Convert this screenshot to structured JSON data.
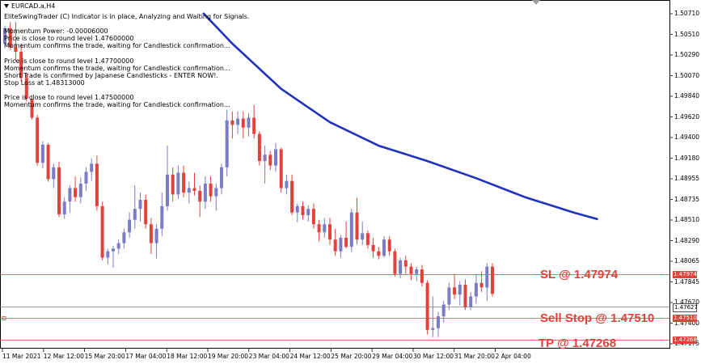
{
  "chart": {
    "symbol_label": "EURCAD.a,H4",
    "indicator_lines": [
      "EliteSwingTrader (C) Indicator is in place, Analyzing and Waiting for Signals.",
      "",
      "Momentum Power: -0.00006000",
      "Price is close to round level 1.47600000",
      "Momentum confirms the trade, waiting for Candlestick confirmation...",
      "",
      "Price is close to round level 1.47700000",
      "Momentum confirms the trade, waiting for Candlestick confirmation...",
      "Short Trade is confirmed by Japanese Candlesticks - ENTER NOW!.",
      "Stop Loss at 1.48313000",
      "",
      "Price is close to round level 1.47500000",
      "Momentum confirms the trade, waiting for Candlestick confirmation..."
    ],
    "levels": {
      "sl_text": "SL @ 1.47974",
      "entry_text": "Sell Stop @ 1.47510",
      "tp_text": "TP @ 1.47268",
      "sl_tag": "1.47974",
      "current_tag": "1.47627",
      "entry_tag": "1.47510",
      "tp_tag": "1.47268"
    },
    "colors": {
      "bull": "#7b7bc6",
      "bear": "#e3413b",
      "ma": "#1f32c0",
      "level_line": "#e3413b",
      "current_line": "#7f7f7f",
      "annotation": "#e3413b"
    }
  },
  "chart_data": {
    "type": "candlestick",
    "title": "EURCAD.a,H4",
    "ylim": [
      1.47175,
      1.5079
    ],
    "y_ticks": [
      "1.50710",
      "1.50510",
      "1.50290",
      "1.50070",
      "1.49840",
      "1.49620",
      "1.49400",
      "1.49180",
      "1.48955",
      "1.48735",
      "1.48510",
      "1.48290",
      "1.48065",
      "1.47845",
      "1.47620",
      "1.47400",
      "1.47175"
    ],
    "x_labels": [
      "11 Mar 2021",
      "12 Mar 12:00",
      "15 Mar 20:00",
      "17 Mar 04:00",
      "18 Mar 12:00",
      "19 Mar 20:00",
      "23 Mar 04:00",
      "24 Mar 12:00",
      "25 Mar 20:00",
      "29 Mar 04:00",
      "30 Mar 12:00",
      "31 Mar 20:00",
      "2 Apr 04:00"
    ],
    "candles": [
      [
        1.5045,
        1.5065,
        1.5041,
        1.5062
      ],
      [
        1.5062,
        1.5069,
        1.5038,
        1.5041
      ],
      [
        1.5041,
        1.5069,
        1.5025,
        1.5036
      ],
      [
        1.5036,
        1.5045,
        1.5003,
        1.5007
      ],
      [
        1.5007,
        1.5012,
        1.4981,
        1.4984
      ],
      [
        1.4984,
        1.4988,
        1.4961,
        1.4963
      ],
      [
        1.4963,
        1.4966,
        1.491,
        1.4913
      ],
      [
        1.4913,
        1.4937,
        1.4907,
        1.4933
      ],
      [
        1.4933,
        1.4935,
        1.4892,
        1.4895
      ],
      [
        1.4895,
        1.4912,
        1.4885,
        1.4908
      ],
      [
        1.4908,
        1.4914,
        1.4853,
        1.4856
      ],
      [
        1.4856,
        1.4875,
        1.4851,
        1.487
      ],
      [
        1.487,
        1.4888,
        1.4858,
        1.4885
      ],
      [
        1.4885,
        1.4898,
        1.487,
        1.4875
      ],
      [
        1.4875,
        1.4897,
        1.4868,
        1.489
      ],
      [
        1.489,
        1.4908,
        1.4882,
        1.4903
      ],
      [
        1.4903,
        1.4918,
        1.4893,
        1.4912
      ],
      [
        1.4912,
        1.4921,
        1.486,
        1.4865
      ],
      [
        1.4865,
        1.487,
        1.4805,
        1.4808
      ],
      [
        1.4808,
        1.4818,
        1.4801,
        1.4815
      ],
      [
        1.4815,
        1.4821,
        1.4797,
        1.4818
      ],
      [
        1.4818,
        1.4828,
        1.4812,
        1.4824
      ],
      [
        1.4824,
        1.484,
        1.4818,
        1.4836
      ],
      [
        1.4836,
        1.4858,
        1.483,
        1.485
      ],
      [
        1.485,
        1.4888,
        1.484,
        1.4862
      ],
      [
        1.4862,
        1.488,
        1.4848,
        1.4872
      ],
      [
        1.4872,
        1.4878,
        1.484,
        1.4845
      ],
      [
        1.4845,
        1.4852,
        1.4812,
        1.4824
      ],
      [
        1.4824,
        1.4845,
        1.4807,
        1.484
      ],
      [
        1.484,
        1.488,
        1.4832,
        1.4865
      ],
      [
        1.4865,
        1.4932,
        1.486,
        1.49
      ],
      [
        1.49,
        1.4908,
        1.487,
        1.4878
      ],
      [
        1.4878,
        1.491,
        1.4873,
        1.4902
      ],
      [
        1.4902,
        1.491,
        1.4875,
        1.488
      ],
      [
        1.488,
        1.4892,
        1.4868,
        1.4885
      ],
      [
        1.4885,
        1.4902,
        1.4877,
        1.4882
      ],
      [
        1.4882,
        1.4888,
        1.4853,
        1.487
      ],
      [
        1.487,
        1.4898,
        1.4862,
        1.489
      ],
      [
        1.489,
        1.4898,
        1.487,
        1.4876
      ],
      [
        1.4876,
        1.489,
        1.486,
        1.4885
      ],
      [
        1.4885,
        1.4912,
        1.4878,
        1.4908
      ],
      [
        1.4908,
        1.4972,
        1.4898,
        1.496
      ],
      [
        1.496,
        1.497,
        1.494,
        1.4955
      ],
      [
        1.4955,
        1.497,
        1.4945,
        1.4962
      ],
      [
        1.4962,
        1.497,
        1.494,
        1.4952
      ],
      [
        1.4952,
        1.4968,
        1.4942,
        1.4963
      ],
      [
        1.4963,
        1.4977,
        1.494,
        1.4945
      ],
      [
        1.4945,
        1.4948,
        1.491,
        1.4915
      ],
      [
        1.4915,
        1.4932,
        1.489,
        1.4922
      ],
      [
        1.4922,
        1.4926,
        1.4905,
        1.491
      ],
      [
        1.491,
        1.4935,
        1.4903,
        1.4928
      ],
      [
        1.4928,
        1.493,
        1.488,
        1.4885
      ],
      [
        1.4885,
        1.49,
        1.4878,
        1.4893
      ],
      [
        1.4893,
        1.49,
        1.4855,
        1.4858
      ],
      [
        1.4858,
        1.4868,
        1.4847,
        1.4865
      ],
      [
        1.4865,
        1.487,
        1.485,
        1.4855
      ],
      [
        1.4855,
        1.4866,
        1.4848,
        1.4862
      ],
      [
        1.4862,
        1.4868,
        1.484,
        1.4845
      ],
      [
        1.4845,
        1.485,
        1.4826,
        1.4836
      ],
      [
        1.4836,
        1.4852,
        1.483,
        1.4845
      ],
      [
        1.4845,
        1.4852,
        1.4822,
        1.4828
      ],
      [
        1.4828,
        1.484,
        1.481,
        1.4815
      ],
      [
        1.4815,
        1.4833,
        1.4808,
        1.483
      ],
      [
        1.483,
        1.4848,
        1.4818,
        1.482
      ],
      [
        1.482,
        1.4862,
        1.4814,
        1.4858
      ],
      [
        1.4858,
        1.4874,
        1.4823,
        1.4828
      ],
      [
        1.4828,
        1.4848,
        1.4822,
        1.4835
      ],
      [
        1.4835,
        1.4838,
        1.4818,
        1.4822
      ],
      [
        1.4822,
        1.483,
        1.4808,
        1.4815
      ],
      [
        1.4815,
        1.482,
        1.4806,
        1.481
      ],
      [
        1.481,
        1.4832,
        1.4808,
        1.4828
      ],
      [
        1.4828,
        1.4832,
        1.481,
        1.4815
      ],
      [
        1.4815,
        1.4818,
        1.4787,
        1.479
      ],
      [
        1.479,
        1.4808,
        1.4785,
        1.4805
      ],
      [
        1.4805,
        1.481,
        1.479,
        1.4798
      ],
      [
        1.4798,
        1.4802,
        1.4783,
        1.479
      ],
      [
        1.479,
        1.4798,
        1.4782,
        1.4795
      ],
      [
        1.4795,
        1.48,
        1.4776,
        1.478
      ],
      [
        1.478,
        1.4783,
        1.4723,
        1.4728
      ],
      [
        1.4728,
        1.4765,
        1.472,
        1.473
      ],
      [
        1.473,
        1.4748,
        1.472,
        1.4743
      ],
      [
        1.4743,
        1.476,
        1.4736,
        1.4756
      ],
      [
        1.4756,
        1.478,
        1.475,
        1.4775
      ],
      [
        1.4775,
        1.479,
        1.4762,
        1.4767
      ],
      [
        1.4767,
        1.4782,
        1.4755,
        1.4778
      ],
      [
        1.4778,
        1.4784,
        1.475,
        1.4753
      ],
      [
        1.4753,
        1.477,
        1.475,
        1.4765
      ],
      [
        1.4765,
        1.479,
        1.4757,
        1.478
      ],
      [
        1.478,
        1.4793,
        1.477,
        1.4775
      ],
      [
        1.4775,
        1.4802,
        1.476,
        1.4798
      ],
      [
        1.4798,
        1.4802,
        1.4765,
        1.4768
      ]
    ],
    "moving_average": [
      {
        "i": 14,
        "v": 1.5079
      },
      {
        "i": 20,
        "v": 1.5045
      },
      {
        "i": 30,
        "v": 1.4995
      },
      {
        "i": 40,
        "v": 1.4958
      },
      {
        "i": 50,
        "v": 1.4932
      },
      {
        "i": 60,
        "v": 1.4915
      },
      {
        "i": 70,
        "v": 1.4896
      },
      {
        "i": 80,
        "v": 1.4875
      },
      {
        "i": 90,
        "v": 1.4858
      },
      {
        "i": 95,
        "v": 1.48505
      }
    ],
    "levels": {
      "sl": 1.47974,
      "current": 1.47627,
      "entry": 1.4751,
      "tp": 1.47268
    }
  }
}
